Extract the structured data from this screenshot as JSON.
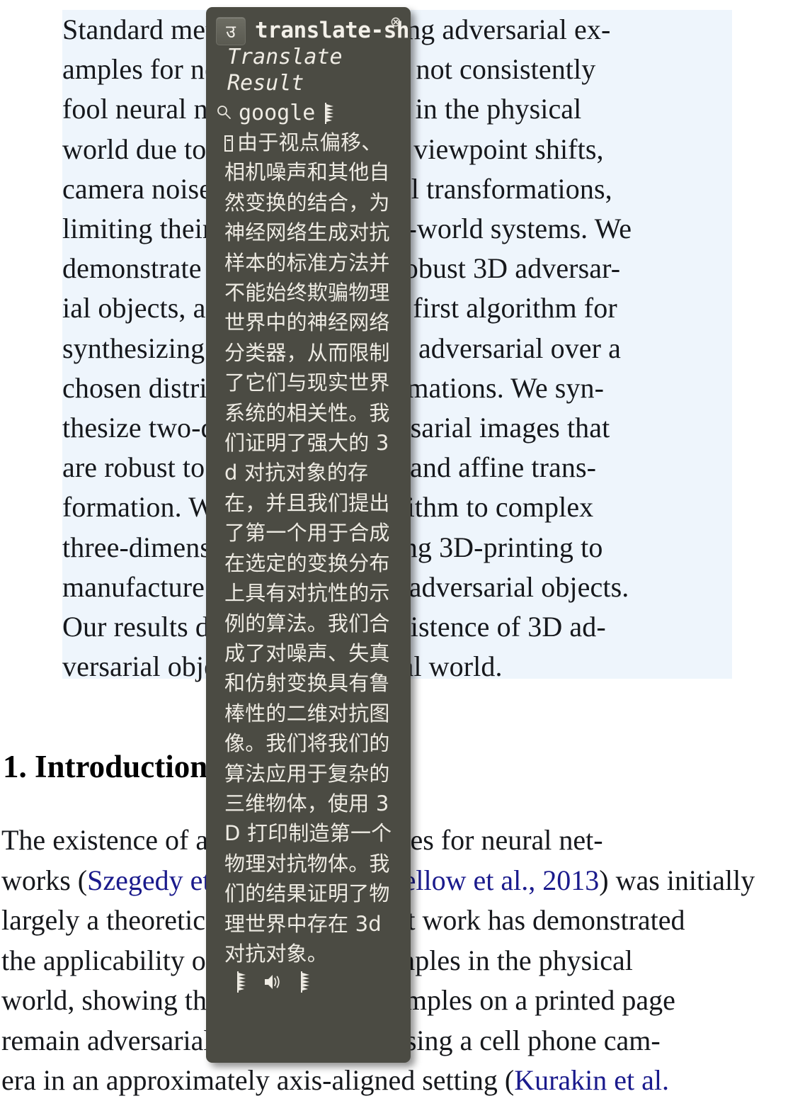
{
  "paper": {
    "abstract_lines": [
      "Standard methods for generating adversarial ex-",
      "amples for neural networks do not consistently",
      "fool neural network classifiers in the physical",
      "world due to a combination of viewpoint shifts,",
      "camera noise, and other natural transformations,",
      "limiting their relevance to real-world systems. We",
      "demonstrate the existence of robust 3D adversar-",
      "ial objects, and we present the first algorithm for",
      "synthesizing examples that are adversarial over a",
      "chosen distribution of transformations. We syn-",
      "thesize two-dimensional adversarial images that",
      "are robust to noise, distortion, and affine trans-",
      "formation. We apply our algorithm to complex",
      "three-dimensional objects, using 3D-printing to",
      "manufacture the first physical adversarial objects.",
      "Our results demonstrate the existence of 3D ad-",
      "versarial objects in the physical world."
    ],
    "section_heading": "1. Introduction",
    "intro_lines": [
      [
        {
          "t": "The  existence  of  adversarial  examples  for  neural  net-",
          "cite": false
        }
      ],
      [
        {
          "t": "works (",
          "cite": false
        },
        {
          "t": "Szegedy et al., 2013; Goodfellow et al., 2013",
          "cite": true
        },
        {
          "t": ") was initially",
          "cite": false
        }
      ],
      [
        {
          "t": "largely a theoretical concern. Recent work has demonstrated",
          "cite": false
        }
      ],
      [
        {
          "t": "the applicability of adversarial examples in the physical",
          "cite": false
        }
      ],
      [
        {
          "t": "world, showing that adversarial examples on a printed page",
          "cite": false
        }
      ],
      [
        {
          "t": "remain adversarial when captured using a cell phone cam-",
          "cite": false
        }
      ],
      [
        {
          "t": "era in an approximately axis-aligned setting (",
          "cite": false
        },
        {
          "t": "Kurakin et al.",
          "cite": true
        }
      ]
    ],
    "selection_color": "#eef5fc",
    "citation_color": "#1a1a8c"
  },
  "popup": {
    "brand_glyph": "उ",
    "brand_name": "translate-sh",
    "close_label": "⊗",
    "subtitle": "Translate Result",
    "engine_icon": "search-icon",
    "engine_name": "google",
    "result_text": "由于视点偏移、相机噪声和其他自然变换的结合，为神经网络生成对抗样本的标准方法并不能始终欺骗物理世界中的神经网络分类器，从而限制了它们与现实世界系统的相关性。我们证明了强大的 3d 对抗对象的存在，并且我们提出了第一个用于合成在选定的变换分布上具有对抗性的示例的算法。我们合成了对噪声、失真和仿射变换具有鲁棒性的二维对抗图像。我们将我们的算法应用于复杂的三维物体，使用 3D 打印制造第一个物理对抗物体。我们的结果证明了物理世界中存在 3d 对抗对象。",
    "icons": {
      "copy_left": "quill-icon",
      "speak": "speaker-icon",
      "copy_right": "quill-icon"
    },
    "background_color": "#4b4b43",
    "text_color": "#efece4"
  }
}
